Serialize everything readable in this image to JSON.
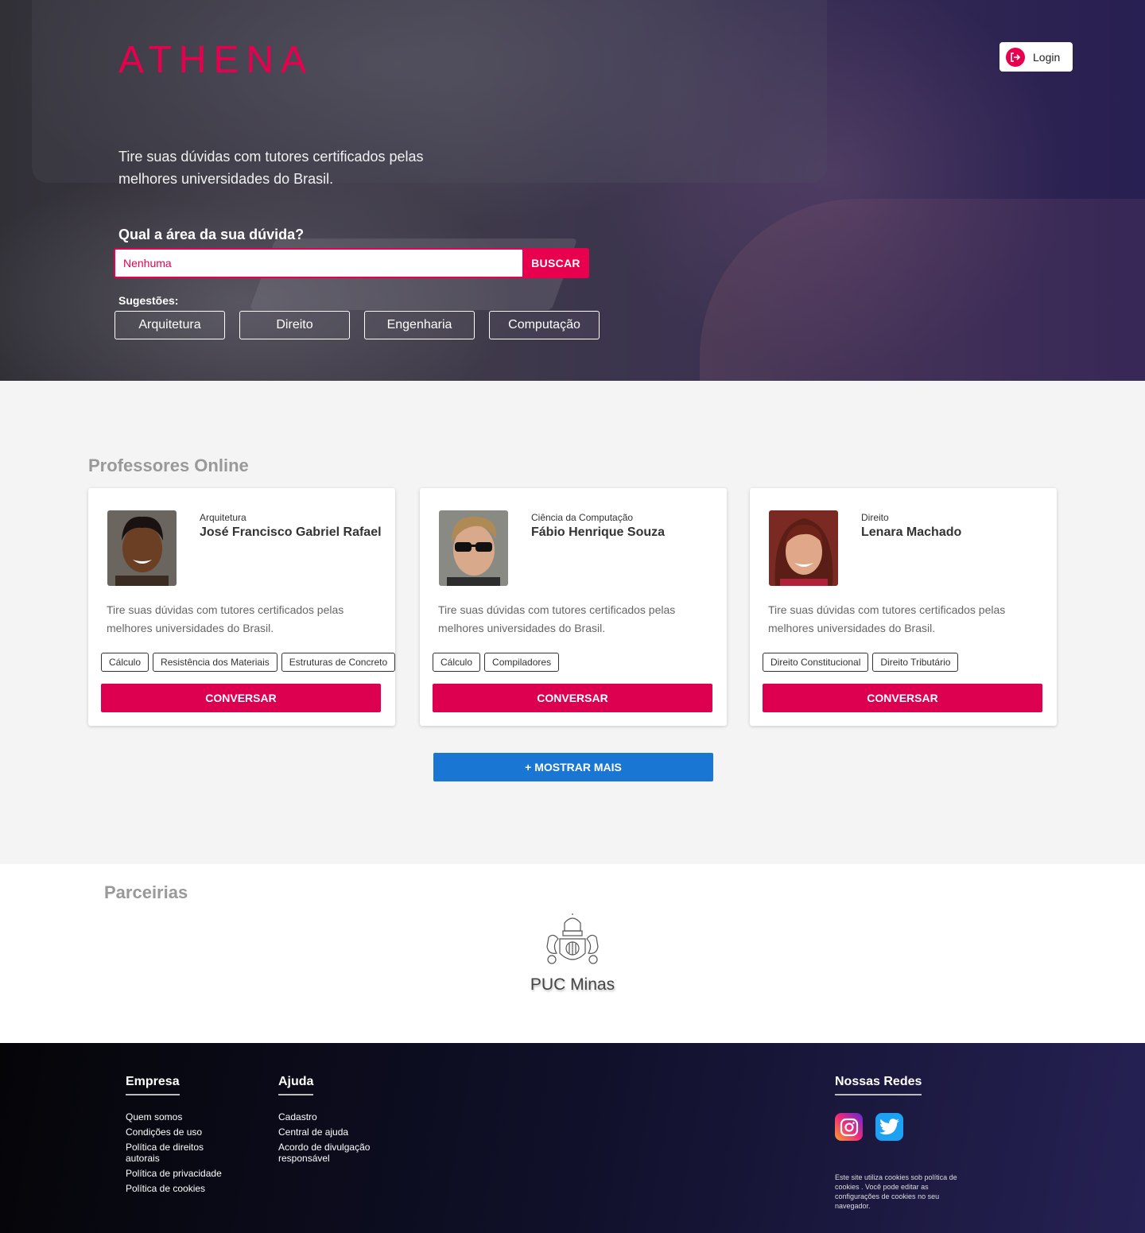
{
  "header": {
    "logo": "ATHENA",
    "login_label": "Login"
  },
  "hero": {
    "tagline": "Tire suas dúvidas com tutores certificados pelas melhores universidades do Brasil.",
    "question": "Qual a  área da sua dúvida?",
    "search_value": "Nenhuma",
    "search_button": "BUSCAR",
    "suggestions_label": "Sugestões:",
    "suggestions": [
      "Arquitetura",
      "Direito",
      "Engenharia",
      "Computação"
    ]
  },
  "professors": {
    "title": "Professores Online",
    "cards": [
      {
        "area": "Arquitetura",
        "name": "José Francisco Gabriel Rafael",
        "description": "Tire suas dúvidas com tutores certificados pelas melhores universidades do Brasil.",
        "tags": [
          "Cálculo",
          "Resistência dos Materiais",
          "Estruturas de Concreto"
        ],
        "button": "CONVERSAR"
      },
      {
        "area": "Ciência da Computação",
        "name": "Fábio Henrique Souza",
        "description": "Tire suas dúvidas com tutores certificados pelas melhores universidades do Brasil.",
        "tags": [
          "Cálculo",
          "Compiladores"
        ],
        "button": "CONVERSAR"
      },
      {
        "area": "Direito",
        "name": "Lenara Machado",
        "description": "Tire suas dúvidas com tutores certificados pelas melhores universidades do Brasil.",
        "tags": [
          "Direito Constitucional",
          "Direito Tributário"
        ],
        "button": "CONVERSAR"
      }
    ],
    "more_button": "+ MOSTRAR MAIS"
  },
  "partners": {
    "title": "Parceirias",
    "logo_text": "PUC Minas"
  },
  "footer": {
    "empresa": {
      "title": "Empresa",
      "links": [
        "Quem somos",
        "Condições de uso",
        "Política de direitos autorais",
        "Política de privacidade",
        "Política de cookies"
      ]
    },
    "ajuda": {
      "title": "Ajuda",
      "links": [
        "Cadastro",
        "Central de ajuda",
        "Acordo de divulgação responsável"
      ]
    },
    "redes": {
      "title": "Nossas Redes",
      "icons": [
        "instagram-icon",
        "twitter-icon"
      ],
      "cookie_notice": "Este site utiliza cookies sob política de cookies . Você pode editar as configurações de cookies no seu navegador."
    }
  },
  "colors": {
    "brand": "#e8004f",
    "button_primary": "#de0050",
    "button_more": "#1976d2"
  }
}
